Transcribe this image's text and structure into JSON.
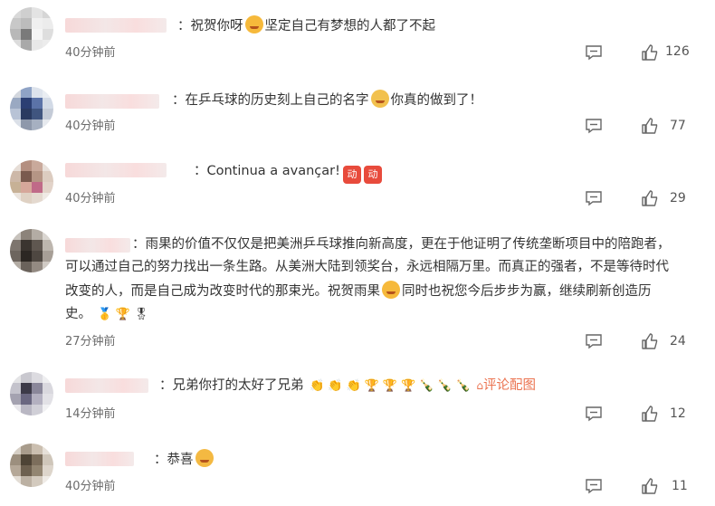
{
  "comments": [
    {
      "text_a": "：祝贺你呀",
      "text_b": "坚定自己有梦想的人都了不起",
      "time": "40分钟前",
      "likes": "126"
    },
    {
      "text_a": "：在乒乓球的历史刻上自己的名字",
      "text_b": "你真的做到了！",
      "time": "40分钟前",
      "likes": "77"
    },
    {
      "text_a": "：Continua a avançar!",
      "sticker": "动",
      "time": "40分钟前",
      "likes": "29"
    },
    {
      "line1": "：雨果的价值不仅仅是把美洲乒乓球推向新高度，更在于他证明了传统垄断项目中的陪跑者，",
      "line2": "可以通过自己的努力找出一条生路。从美洲大陆到领奖台，永远相隔万里。而真正的强者，不是等待时代",
      "line3a": "改变的人，而是自己成为改变时代的那束光。祝贺雨果",
      "line3b": "同时也祝您今后步步为赢，继续刷新创造历",
      "line4": "史。",
      "time": "27分钟前",
      "likes": "24"
    },
    {
      "text_a": "：兄弟你打的太好了兄弟",
      "link": "评论配图",
      "time": "14分钟前",
      "likes": "12"
    },
    {
      "text_a": "：恭喜",
      "time": "40分钟前",
      "likes": "11"
    }
  ],
  "icons": {
    "reply": "reply-icon",
    "like": "thumbs-up-icon"
  }
}
